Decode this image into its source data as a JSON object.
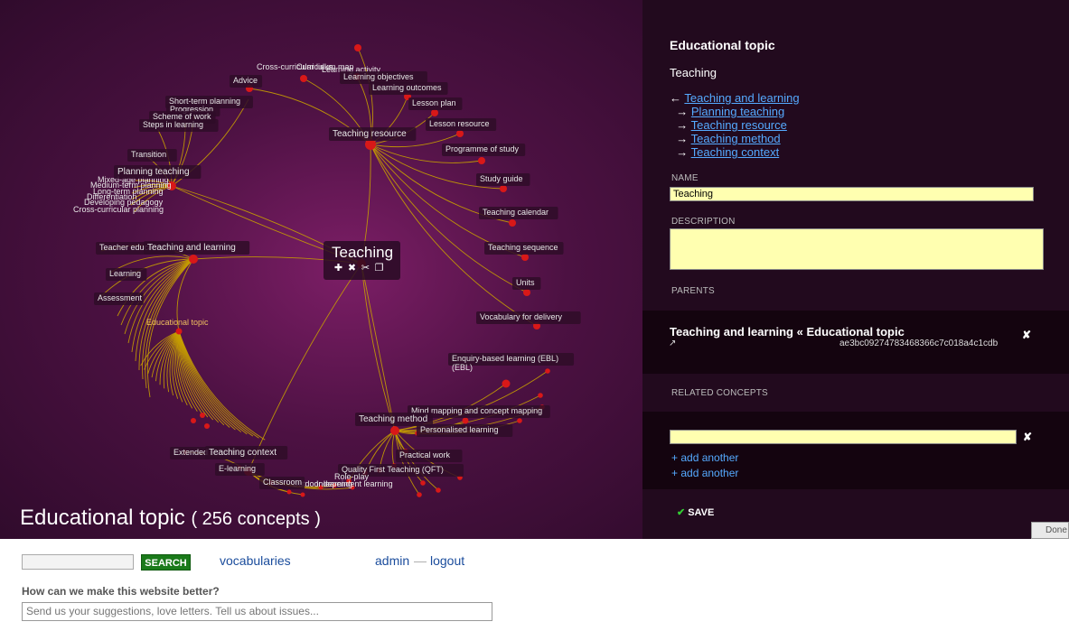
{
  "graph": {
    "title": "Educational topic",
    "count": "( 256 concepts )",
    "selected": {
      "label": "Teaching",
      "tool_icons": [
        "plus-icon",
        "delete-icon",
        "cut-icon",
        "copy-icon"
      ]
    },
    "hubs": [
      {
        "id": "teaching_resource",
        "label": "Teaching resource"
      },
      {
        "id": "planning_teaching",
        "label": "Planning teaching"
      },
      {
        "id": "teaching_and_learning",
        "label": "Teaching and learning"
      },
      {
        "id": "teaching_method",
        "label": "Teaching method"
      },
      {
        "id": "teaching_context",
        "label": "Teaching context"
      }
    ],
    "teaching_resource_children": [
      "Cross-curricular links",
      "Curriculum map",
      "Learning activity",
      "Learning objectives",
      "Learning outcomes",
      "Lesson plan",
      "Lesson resource",
      "Programme of study",
      "Study guide",
      "Teaching calendar",
      "Teaching sequence",
      "Units",
      "Vocabulary for delivery",
      "Advice"
    ],
    "planning_teaching_children": [
      "Short-term planning",
      "Progression",
      "Scheme of work",
      "Steps in learning",
      "Transition",
      "Mixed-age planning",
      "Medium-term planning",
      "Long-term planning",
      "Differentiation",
      "Developing pedagogy",
      "Cross-curricular planning"
    ],
    "teaching_and_learning_children": [
      "Teacher education",
      "Learning",
      "Assessment",
      "Educational topic"
    ],
    "teaching_method_children": [
      "Enquiry-based learning (EBL)",
      "Mind mapping and concept mapping",
      "Personalised learning",
      "Practical work",
      "Quality First Teaching (QFT)",
      "Role-play",
      "Outdoor learning",
      "Independent learning"
    ],
    "teaching_context_children": [
      "Extended schools",
      "E-learning",
      "Classroom"
    ]
  },
  "panel": {
    "heading": "Educational topic",
    "concept": "Teaching",
    "tree": {
      "parent": "Teaching and learning",
      "children": [
        "Planning teaching",
        "Teaching resource",
        "Teaching method",
        "Teaching context"
      ],
      "up_arrow": "←",
      "down_arrow": "→"
    },
    "name_label": "NAME",
    "name_value": "Teaching",
    "description_label": "DESCRIPTION",
    "description_value": "",
    "parents_label": "PARENTS",
    "parent_item": {
      "title": "Teaching and learning « Educational topic",
      "hash": "ae3bc09274783468366c7c018a4c1cdb"
    },
    "related_label": "RELATED CONCEPTS",
    "related_value": "",
    "add_another": [
      "+ add another",
      "+ add another"
    ],
    "save": "SAVE",
    "done": "Done"
  },
  "footer": {
    "search_placeholder": "",
    "search_button": "SEARCH",
    "vocabularies": "vocabularies",
    "admin": "admin",
    "separator": "—",
    "logout": "logout",
    "feedback_question": "How can we make this website better?",
    "feedback_placeholder": "Send us your suggestions, love letters. Tell us about issues..."
  },
  "colors": {
    "edge": "#c8a000",
    "node": "#d81818",
    "link": "#55aaff",
    "save_button": "#1a7a1a",
    "input_bg": "#ffffb0"
  }
}
